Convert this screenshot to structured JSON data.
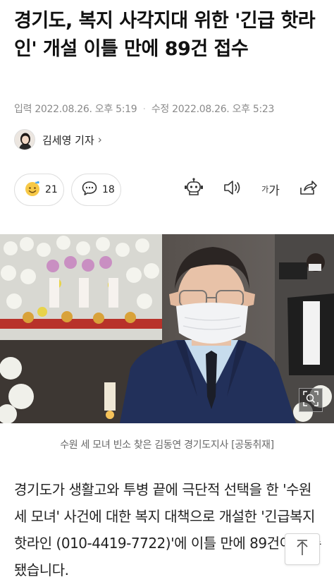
{
  "article": {
    "headline": "경기도, 복지 사각지대 위한 '긴급 핫라인' 개설 이틀 만에 89건 접수",
    "published_label": "입력",
    "published": "2022.08.26. 오후 5:19",
    "modified_label": "수정",
    "modified": "2022.08.26. 오후 5:23",
    "reporter": "김세영 기자",
    "photo_caption": "수원 세 모녀 빈소 찾은 김동연 경기도지사 [공동취재]",
    "body": "경기도가 생활고와 투병 끝에 극단적 선택을 한 '수원 세 모녀' 사건에 대한 복지 대책으로 개설한 '긴급복지 핫라인 (010-4419-7722)'에 이틀 만에 89건이 접수됐습니다."
  },
  "actions": {
    "reaction_count": "21",
    "comment_count": "18",
    "font_small": "가",
    "font_big": "가"
  },
  "icons": {
    "reaction": "smiley-face-icon",
    "comment": "speech-bubble-icon",
    "summary": "robot-icon",
    "audio": "speaker-icon",
    "share": "share-icon",
    "zoom": "zoom-magnifier-icon",
    "top": "arrow-up-icon"
  },
  "colors": {
    "text": "#111111",
    "meta": "#8a8a8a",
    "border": "#dedede",
    "reaction_yellow": "#f7c948"
  }
}
